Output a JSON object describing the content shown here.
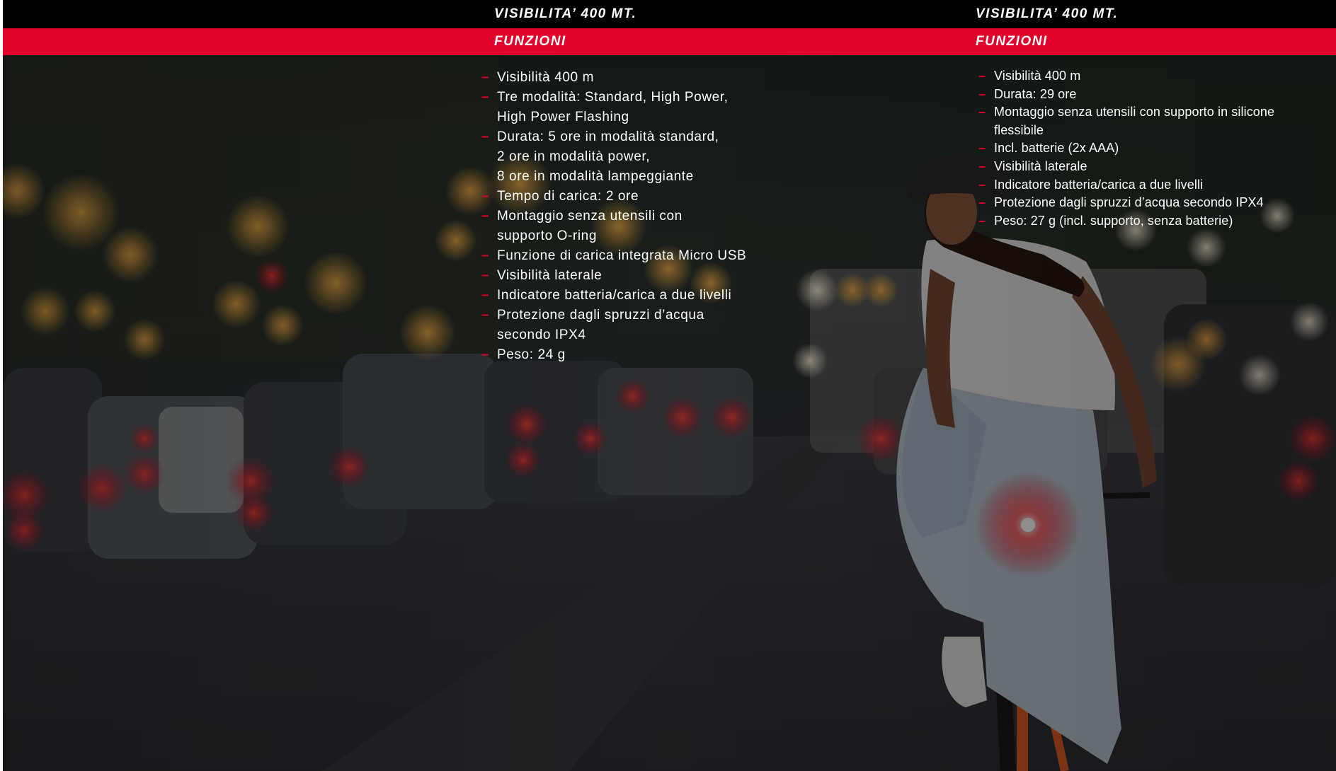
{
  "colors": {
    "header_bg": "#000000",
    "accent_red": "#e0002a",
    "text": "#ffffff"
  },
  "columns": [
    {
      "title": "VISIBILITA’ 400 MT.",
      "section_label": "FUNZIONI",
      "features": [
        [
          "Visibilità 400 m"
        ],
        [
          "Tre modalità: Standard, High Power,",
          "High Power Flashing"
        ],
        [
          "Durata: 5 ore in modalità standard,",
          "2 ore in modalità power,",
          "8 ore in modalità lampeggiante"
        ],
        [
          "Tempo di carica: 2 ore"
        ],
        [
          "Montaggio senza utensili con",
          "supporto O-ring"
        ],
        [
          "Funzione di carica integrata Micro USB"
        ],
        [
          "Visibilità laterale"
        ],
        [
          "Indicatore batteria/carica a due livelli"
        ],
        [
          "Protezione dagli spruzzi d’acqua",
          "secondo IPX4"
        ],
        [
          "Peso: 24 g"
        ]
      ]
    },
    {
      "title": "VISIBILITA’ 400 MT.",
      "section_label": "FUNZIONI",
      "features": [
        [
          "Visibilità 400 m"
        ],
        [
          "Durata: 29 ore"
        ],
        [
          "Montaggio senza utensili con supporto in silicone",
          "flessibile"
        ],
        [
          "Incl. batterie (2x AAA)"
        ],
        [
          "Visibilità laterale"
        ],
        [
          "Indicatore batteria/carica a due livelli"
        ],
        [
          "Protezione dagli spruzzi d’acqua secondo IPX4"
        ],
        [
          "Peso: 27 g (incl. supporto, senza batterie)"
        ]
      ]
    }
  ]
}
